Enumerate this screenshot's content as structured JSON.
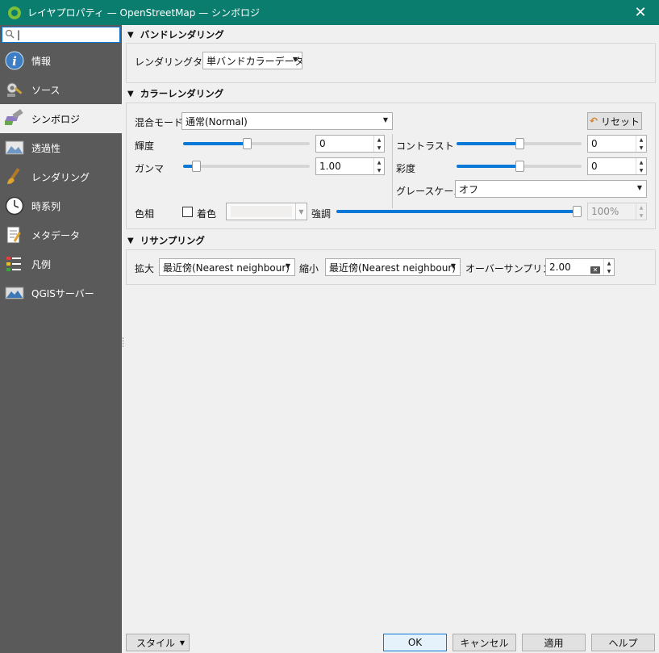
{
  "window": {
    "title": "レイヤプロパティ — OpenStreetMap — シンボロジ",
    "close_glyph": "✕"
  },
  "sidebar": {
    "search_value": "",
    "items": [
      {
        "label": "情報",
        "icon": "info-icon"
      },
      {
        "label": "ソース",
        "icon": "source-icon"
      },
      {
        "label": "シンボロジ",
        "icon": "symbology-icon",
        "active": true
      },
      {
        "label": "透過性",
        "icon": "transparency-icon"
      },
      {
        "label": "レンダリング",
        "icon": "rendering-icon"
      },
      {
        "label": "時系列",
        "icon": "clock-icon"
      },
      {
        "label": "メタデータ",
        "icon": "metadata-icon"
      },
      {
        "label": "凡例",
        "icon": "legend-icon"
      },
      {
        "label": "QGISサーバー",
        "icon": "server-icon"
      }
    ]
  },
  "band_rendering": {
    "header": "バンドレンダリング",
    "render_type_label": "レンダリングタイプ",
    "render_type_value": "単バンドカラーデータ"
  },
  "color_rendering": {
    "header": "カラーレンダリング",
    "blend_label": "混合モード",
    "blend_value": "通常(Normal)",
    "reset_label": "リセット",
    "brightness_label": "輝度",
    "brightness_value": "0",
    "brightness_level": 0.5,
    "contrast_label": "コントラスト",
    "contrast_value": "0",
    "contrast_level": 0.5,
    "gamma_label": "ガンマ",
    "gamma_value": "1.00",
    "gamma_level": 0.1,
    "saturation_label": "彩度",
    "saturation_value": "0",
    "saturation_level": 0.5,
    "grayscale_label": "グレースケール",
    "grayscale_value": "オフ",
    "hue_label": "色相",
    "colorize_label": "着色",
    "strength_label": "強調",
    "strength_value": "100%",
    "strength_level": 1.0
  },
  "resampling": {
    "header": "リサンプリング",
    "zoomed_in_label": "拡大",
    "zoomed_in_value": "最近傍(Nearest neighbour)",
    "zoomed_out_label": "縮小",
    "zoomed_out_value": "最近傍(Nearest neighbour)",
    "oversampling_label": "オーバーサンプリング",
    "oversampling_value": "2.00"
  },
  "footer": {
    "style_label": "スタイル",
    "ok_label": "OK",
    "cancel_label": "キャンセル",
    "apply_label": "適用",
    "help_label": "ヘルプ"
  }
}
